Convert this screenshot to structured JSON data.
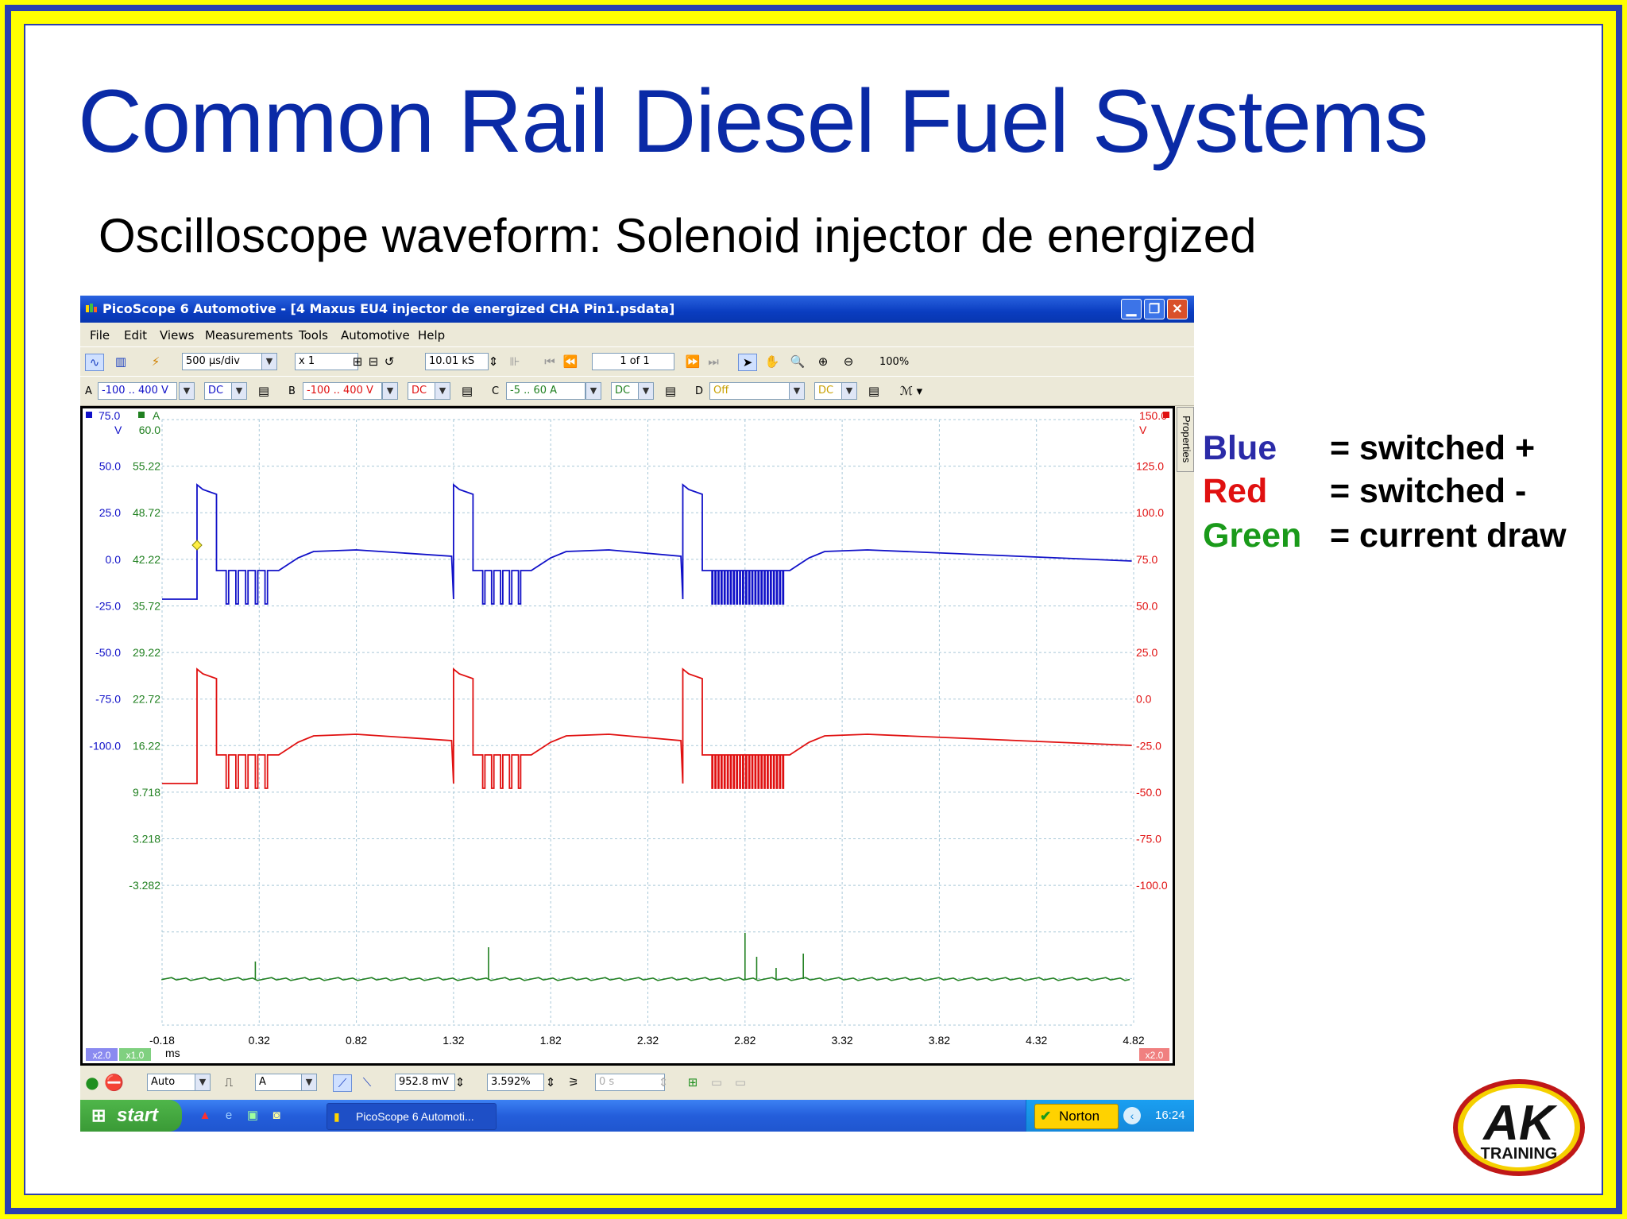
{
  "slide": {
    "title": "Common Rail Diesel Fuel Systems",
    "subtitle": "Oscilloscope waveform: Solenoid injector de energized"
  },
  "window": {
    "title": "PicoScope 6 Automotive - [4 Maxus EU4 injector de energized CHA Pin1.psdata]",
    "menu": [
      "File",
      "Edit",
      "Views",
      "Measurements",
      "Tools",
      "Automotive",
      "Help"
    ]
  },
  "toolbar": {
    "timebase": "500 µs/div",
    "multiplier": "x 1",
    "samples": "10.01 kS",
    "buffer": "1 of 1",
    "zoom": "100%"
  },
  "channels": [
    {
      "letter": "A",
      "range": "-100 .. 400 V",
      "coupling": "DC",
      "color": "#1010c8"
    },
    {
      "letter": "B",
      "range": "-100 .. 400 V",
      "coupling": "DC",
      "color": "#e01010"
    },
    {
      "letter": "C",
      "range": "-5 .. 60 A",
      "coupling": "DC",
      "color": "#208020"
    },
    {
      "letter": "D",
      "range": "Off",
      "coupling": "DC",
      "color": "#c8a000"
    }
  ],
  "scope": {
    "left_header_a": "75.0",
    "left_header_unit_a": "A",
    "left_unit_v": "V",
    "left_header_v": "60.0",
    "right_header": "150.0",
    "right_unit": "V",
    "left_axis_blue": [
      "50.0",
      "25.0",
      "0.0",
      "-25.0",
      "-50.0",
      "-75.0",
      "-100.0"
    ],
    "left_axis_green": [
      "55.22",
      "48.72",
      "42.22",
      "35.72",
      "29.22",
      "22.72",
      "16.22",
      "9.718",
      "3.218",
      "-3.282"
    ],
    "right_axis": [
      "125.0",
      "100.0",
      "75.0",
      "50.0",
      "25.0",
      "0.0",
      "-25.0",
      "-50.0",
      "-75.0",
      "-100.0"
    ],
    "x_ticks": [
      "-0.18",
      "0.32",
      "0.82",
      "1.32",
      "1.82",
      "2.32",
      "2.82",
      "3.32",
      "3.82",
      "4.32",
      "4.82"
    ],
    "x_unit": "ms",
    "zoom_left": "x2.0",
    "zoom_left2": "x1.0",
    "zoom_right": "x2.0",
    "properties_tab": "Properties"
  },
  "bottom": {
    "trigger_mode": "Auto",
    "trigger_channel": "A",
    "threshold": "952.8 mV",
    "pretrigger": "3.592%",
    "delay": "0 s"
  },
  "taskbar": {
    "start": "start",
    "task_label": "PicoScope 6 Automoti...",
    "norton": "Norton",
    "clock": "16:24"
  },
  "legend": [
    {
      "name": "Blue",
      "desc": "= switched +",
      "color": "#2b2ba8"
    },
    {
      "name": "Red",
      "desc": "= switched -",
      "color": "#e01010"
    },
    {
      "name": "Green",
      "desc": "= current draw",
      "color": "#1a9a1a"
    }
  ],
  "logo": {
    "big": "AK",
    "small": "TRAINING"
  }
}
